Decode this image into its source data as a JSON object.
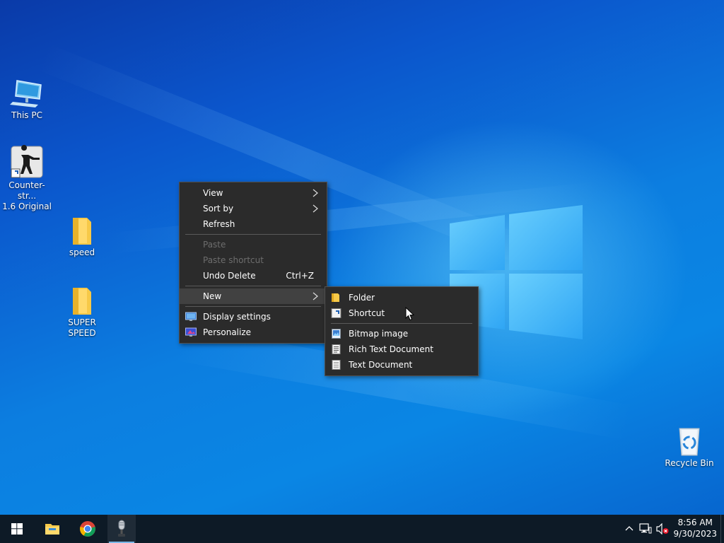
{
  "desktop": {
    "icons": [
      {
        "label": "This PC",
        "icon": "computer-icon"
      },
      {
        "label": "Counter-str...\n1.6 Original",
        "icon": "counter-strike-icon"
      },
      {
        "label": "speed",
        "icon": "folder-icon"
      },
      {
        "label": "SUPER SPEED",
        "icon": "folder-icon"
      },
      {
        "label": "Recycle Bin",
        "icon": "recycle-bin-icon"
      }
    ]
  },
  "context_menu": {
    "items": {
      "view": "View",
      "sort_by": "Sort by",
      "refresh": "Refresh",
      "paste": "Paste",
      "paste_shortcut": "Paste shortcut",
      "undo_delete": "Undo Delete",
      "undo_delete_shortcut": "Ctrl+Z",
      "new": "New",
      "display_settings": "Display settings",
      "personalize": "Personalize"
    }
  },
  "new_submenu": {
    "items": {
      "folder": "Folder",
      "shortcut": "Shortcut",
      "bitmap": "Bitmap image",
      "rtf": "Rich Text Document",
      "text": "Text Document"
    }
  },
  "taskbar": {
    "apps": [
      {
        "name": "Start",
        "icon": "windows-start-icon"
      },
      {
        "name": "File Explorer",
        "icon": "file-explorer-icon"
      },
      {
        "name": "Google Chrome",
        "icon": "chrome-icon"
      },
      {
        "name": "Voice Recorder",
        "icon": "microphone-icon"
      }
    ],
    "tray": {
      "time": "8:56 AM",
      "date": "9/30/2023"
    }
  },
  "colors": {
    "menu_bg": "#2b2b2b",
    "menu_hover": "#414141",
    "taskbar_bg": "#0d1a26",
    "desktop_blue": "#0a86e4"
  }
}
